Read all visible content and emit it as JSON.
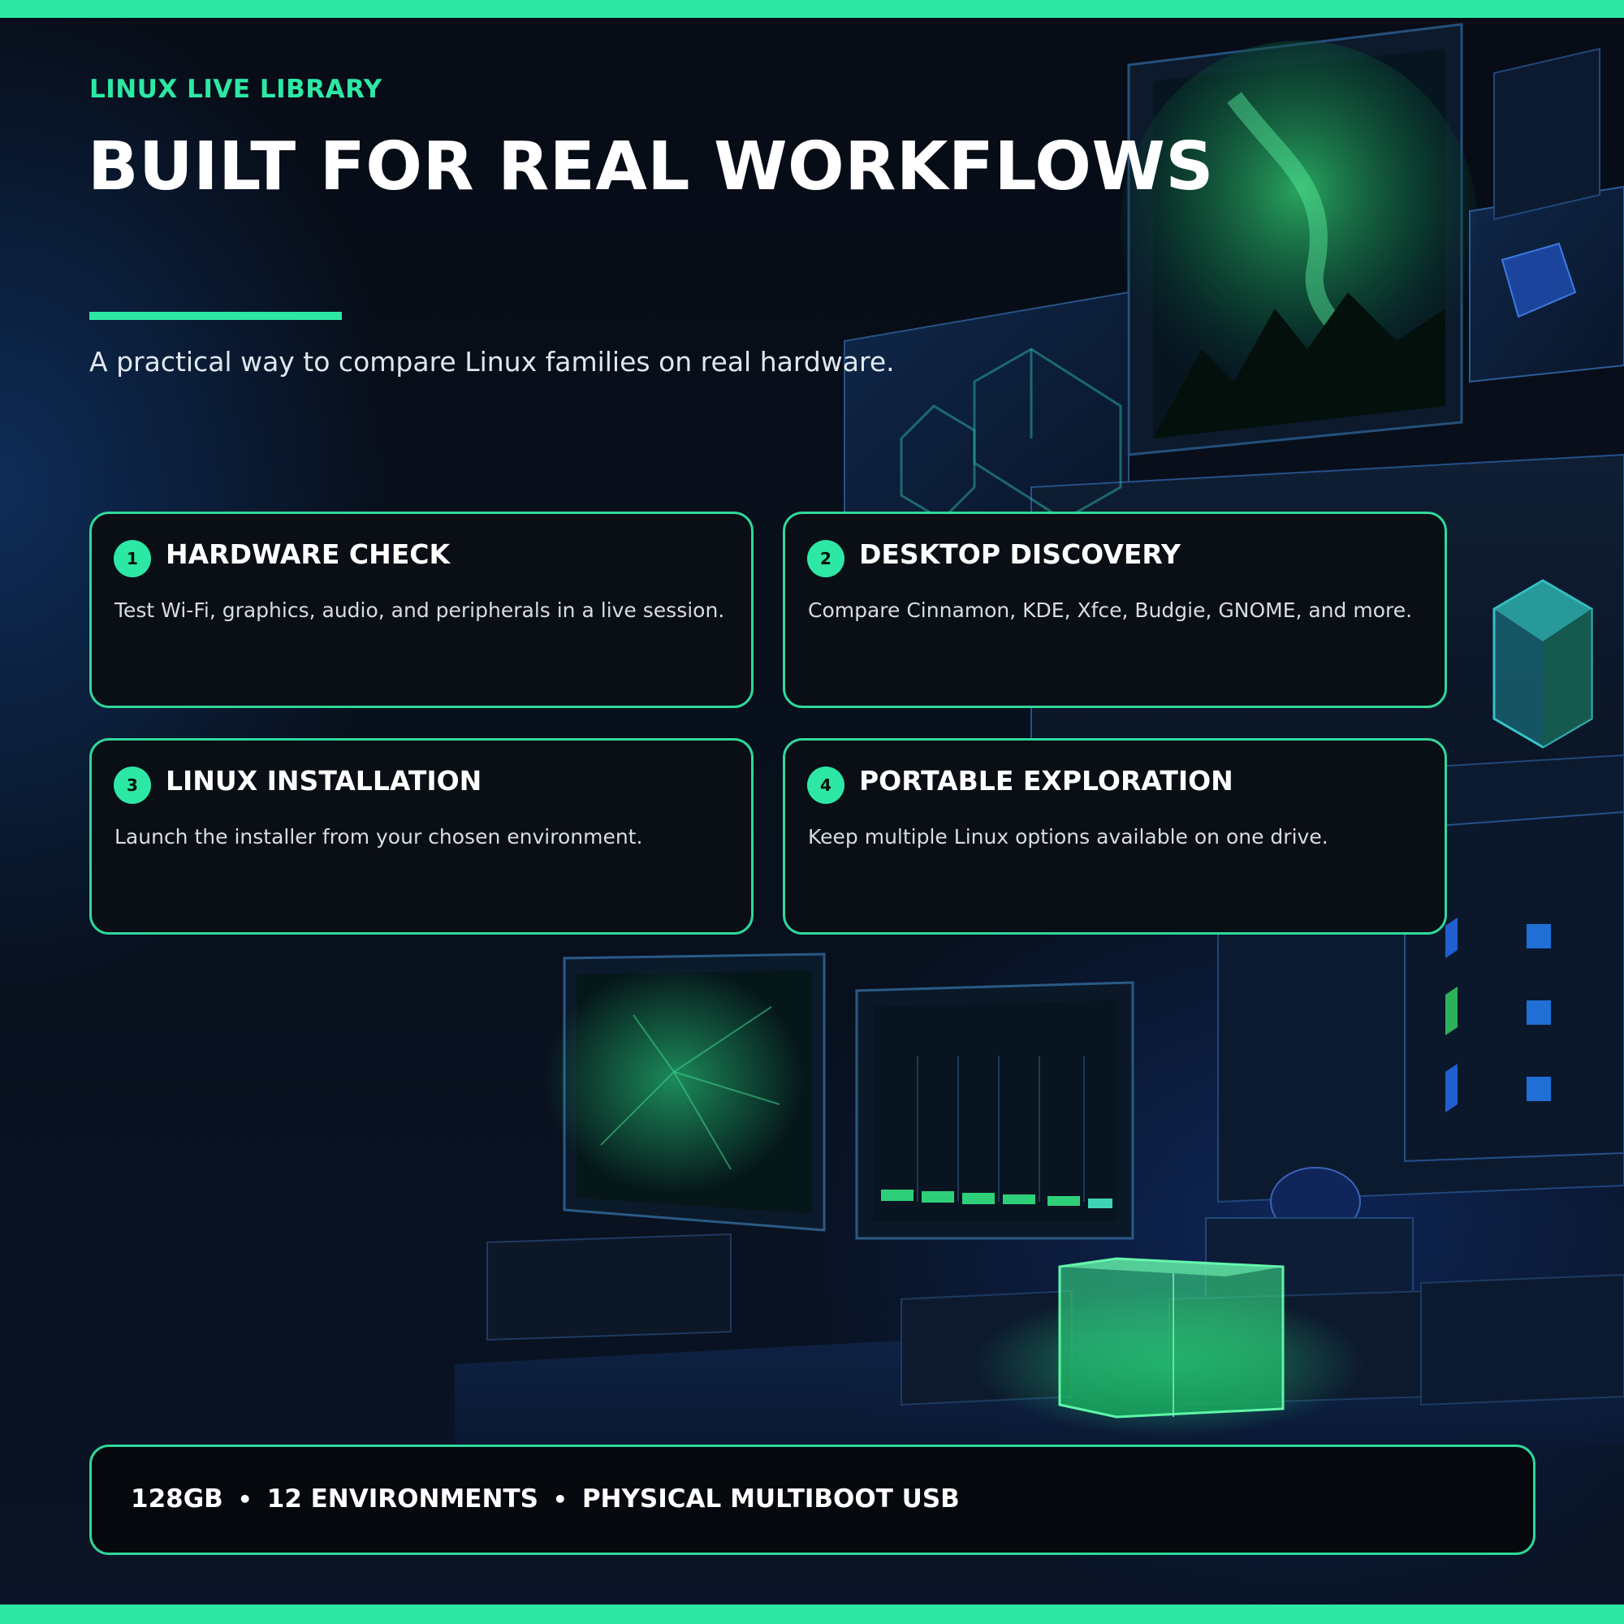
{
  "header": {
    "eyebrow": "LINUX LIVE LIBRARY",
    "title": "BUILT FOR REAL WORKFLOWS",
    "subtitle": "A practical way to compare Linux families on real hardware."
  },
  "cards": [
    {
      "number": "1",
      "title": "HARDWARE CHECK",
      "description": "Test Wi-Fi, graphics, audio, and peripherals in a live session."
    },
    {
      "number": "2",
      "title": "DESKTOP DISCOVERY",
      "description": "Compare Cinnamon, KDE, Xfce, Budgie, GNOME, and more."
    },
    {
      "number": "3",
      "title": "LINUX INSTALLATION",
      "description": "Launch the installer from your chosen environment."
    },
    {
      "number": "4",
      "title": "PORTABLE EXPLORATION",
      "description": "Keep multiple Linux options available on one drive."
    }
  ],
  "footer": {
    "items": [
      "128GB",
      "12 ENVIRONMENTS",
      "PHYSICAL MULTIBOOT USB"
    ],
    "separator": "•"
  },
  "colors": {
    "accent": "#2de8a4",
    "card_border": "#2fd89a",
    "card_background": "#0a0e15",
    "page_background": "#070c16"
  },
  "icons": {
    "number_badge": "circle-number-badge",
    "scene": "glowing-monitors-illustration"
  }
}
